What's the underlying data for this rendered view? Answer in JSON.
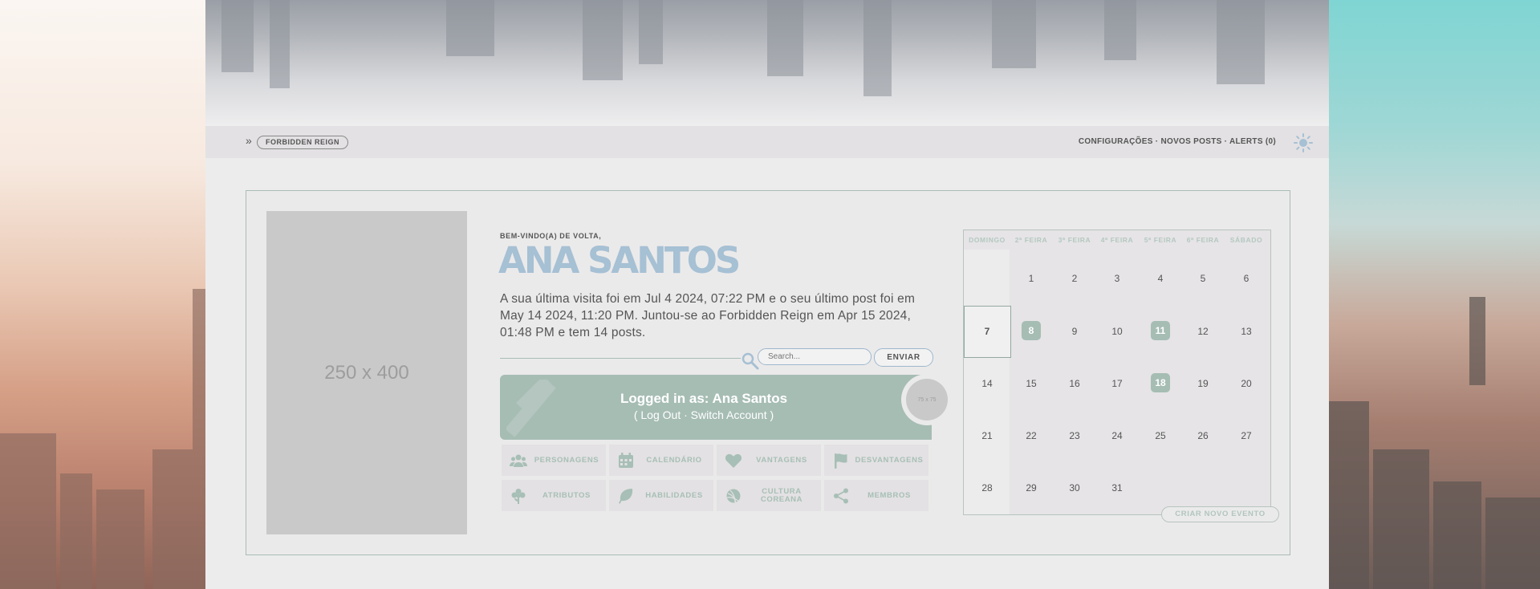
{
  "nav": {
    "arrow": "»",
    "breadcrumb": "FORBIDDEN REIGN",
    "links_text": "CONFIGURAÇÕES · NOVOS POSTS · ALERTS (0)"
  },
  "profile": {
    "avatar_placeholder": "250 x 400",
    "welcome": "BEM-VINDO(A) DE VOLTA,",
    "name": "ANA SANTOS",
    "stats": "A sua última visita foi em Jul 4 2024, 07:22 PM e o seu último post foi em May 14 2024, 11:20 PM. Juntou-se ao Forbidden Reign em Apr 15 2024, 01:48 PM e tem 14 posts."
  },
  "search": {
    "placeholder": "Search...",
    "submit": "ENVIAR"
  },
  "account": {
    "logged_in": "Logged in as: Ana Santos",
    "links": "( Log Out · Switch Account )",
    "small_avatar": "75 x 75"
  },
  "quick_links": [
    {
      "label": "PERSONAGENS",
      "icon": "users-icon"
    },
    {
      "label": "CALENDÁRIO",
      "icon": "calendar-icon"
    },
    {
      "label": "VANTAGENS",
      "icon": "heart-icon"
    },
    {
      "label": "DESVANTAGENS",
      "icon": "flag-icon"
    },
    {
      "label": "ATRIBUTOS",
      "icon": "flower-icon"
    },
    {
      "label": "HABILIDADES",
      "icon": "leaf-icon"
    },
    {
      "label": "CULTURA COREANA",
      "icon": "yarn-icon"
    },
    {
      "label": "MEMBROS",
      "icon": "share-icon"
    }
  ],
  "calendar": {
    "headers": [
      "DOMINGO",
      "2ª FEIRA",
      "3ª FEIRA",
      "4ª FEIRA",
      "5ª FEIRA",
      "6ª FEIRA",
      "SÁBADO"
    ],
    "weeks": [
      [
        "",
        "1",
        "2",
        "3",
        "4",
        "5",
        "6"
      ],
      [
        "7",
        "8",
        "9",
        "10",
        "11",
        "12",
        "13"
      ],
      [
        "14",
        "15",
        "16",
        "17",
        "18",
        "19",
        "20"
      ],
      [
        "21",
        "22",
        "23",
        "24",
        "25",
        "26",
        "27"
      ],
      [
        "28",
        "29",
        "30",
        "31",
        "",
        "",
        ""
      ]
    ],
    "today": "7",
    "event_days": [
      "8",
      "11",
      "18"
    ],
    "create_event": "CRIAR NOVO EVENTO"
  },
  "colors": {
    "accent": "#a6bdb4",
    "name_blue": "#a6c0d4",
    "text": "#555555"
  }
}
